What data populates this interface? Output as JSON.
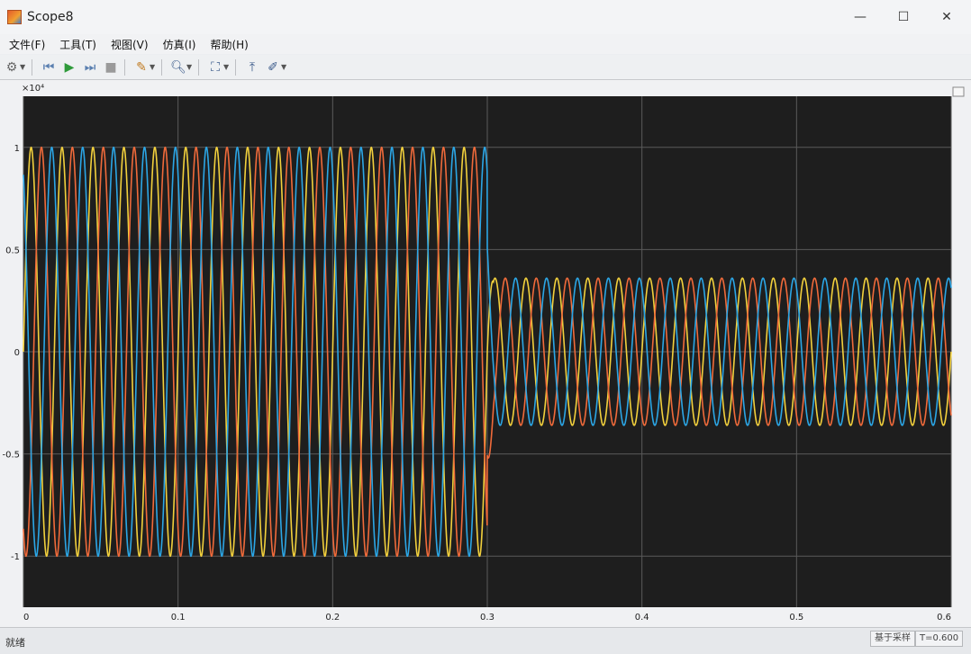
{
  "window": {
    "title": "Scope8",
    "minimize": "—",
    "maximize": "☐",
    "close": "✕"
  },
  "menu": {
    "items": [
      "文件(F)",
      "工具(T)",
      "视图(V)",
      "仿真(I)",
      "帮助(H)"
    ]
  },
  "toolbar": {
    "icons": [
      "gear-icon",
      "step-back-icon",
      "run-icon",
      "step-forward-icon",
      "stop-icon",
      "highlight-icon",
      "zoom-icon",
      "autoscale-icon",
      "measure-icon",
      "edit-icon"
    ]
  },
  "status": {
    "left": "就绪",
    "sampling": "基于采样",
    "time": "T=0.600"
  },
  "chart_data": {
    "type": "line",
    "title": "",
    "xlabel": "",
    "ylabel": "",
    "y_exponent": "×10⁴",
    "xlim": [
      0,
      0.6
    ],
    "ylim": [
      -1.25,
      1.25
    ],
    "x_ticks": [
      "0",
      "0.1",
      "0.2",
      "0.3",
      "0.4",
      "0.5",
      "0.6"
    ],
    "y_ticks": [
      "1",
      "0.5",
      "0",
      "-0.5",
      "-1"
    ],
    "x_tick_values": [
      0,
      0.1,
      0.2,
      0.3,
      0.4,
      0.5,
      0.6
    ],
    "y_tick_values": [
      1,
      0.5,
      0,
      -0.5,
      -1
    ],
    "grid": true,
    "background": "#1e1e1e",
    "frequency_hz": 50,
    "step_time": 0.3,
    "amplitude_before": 1.0,
    "amplitude_after": 0.36,
    "series": [
      {
        "color": "#f2d03c",
        "phase_deg": 0
      },
      {
        "color": "#f06a3a",
        "phase_deg": -120
      },
      {
        "color": "#2ba6e6",
        "phase_deg": 120
      }
    ]
  }
}
